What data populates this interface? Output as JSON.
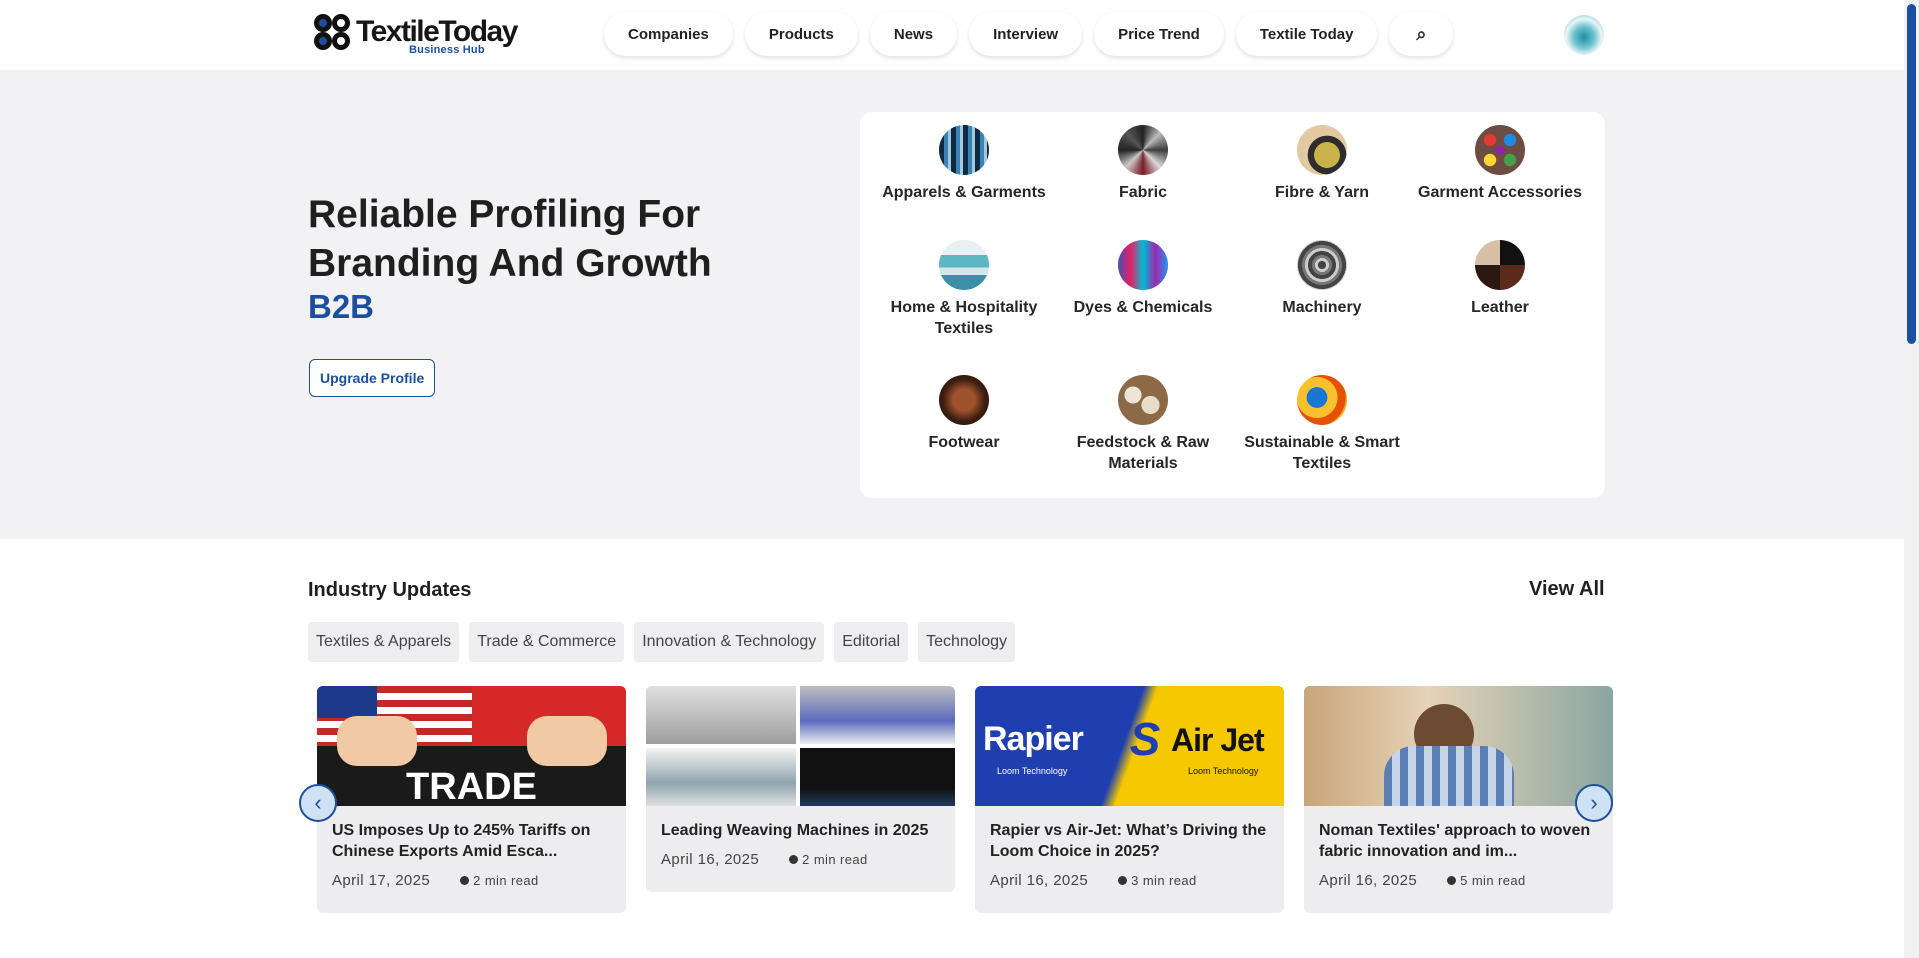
{
  "header": {
    "logo_text": "TextileToday",
    "logo_sub": "Business Hub",
    "nav": [
      "Companies",
      "Products",
      "News",
      "Interview",
      "Price Trend",
      "Textile Today"
    ],
    "search_icon": "⌕"
  },
  "hero": {
    "title": "Reliable Profiling For Branding And Growth",
    "accent": "B2B",
    "upgrade_label": "Upgrade Profile"
  },
  "categories": [
    {
      "label": "Apparels & Garments"
    },
    {
      "label": "Fabric"
    },
    {
      "label": "Fibre & Yarn"
    },
    {
      "label": "Garment Accessories"
    },
    {
      "label": "Home & Hospitality Textiles"
    },
    {
      "label": "Dyes & Chemicals"
    },
    {
      "label": "Machinery"
    },
    {
      "label": "Leather"
    },
    {
      "label": "Footwear"
    },
    {
      "label": "Feedstock & Raw Materials"
    },
    {
      "label": "Sustainable & Smart Textiles"
    }
  ],
  "updates": {
    "title": "Industry Updates",
    "view_all": "View All",
    "chips": [
      "Textiles & Apparels",
      "Trade & Commerce",
      "Innovation & Technology",
      "Editorial",
      "Technology"
    ],
    "cards": [
      {
        "title": "US Imposes Up to 245% Tariffs on Chinese Exports Amid Esca...",
        "date": "April 17, 2025",
        "read": "2 min read",
        "image_text": "TRADE"
      },
      {
        "title": "Leading Weaving Machines in 2025",
        "date": "April 16, 2025",
        "read": "2 min read"
      },
      {
        "title": "Rapier vs Air-Jet: What’s Driving the Loom Choice in 2025?",
        "date": "April 16, 2025",
        "read": "3 min read",
        "image_text_left": "Rapier",
        "image_text_vs": "VS",
        "image_text_right": "Air Jet",
        "image_sub": "Loom Technology"
      },
      {
        "title": "Noman Textiles' approach to woven fabric innovation and im...",
        "date": "April 16, 2025",
        "read": "5 min read"
      }
    ]
  },
  "colors": {
    "accent": "#1c4f9e",
    "hero_bg": "#f2f2f4",
    "card_bg": "#ededef"
  }
}
